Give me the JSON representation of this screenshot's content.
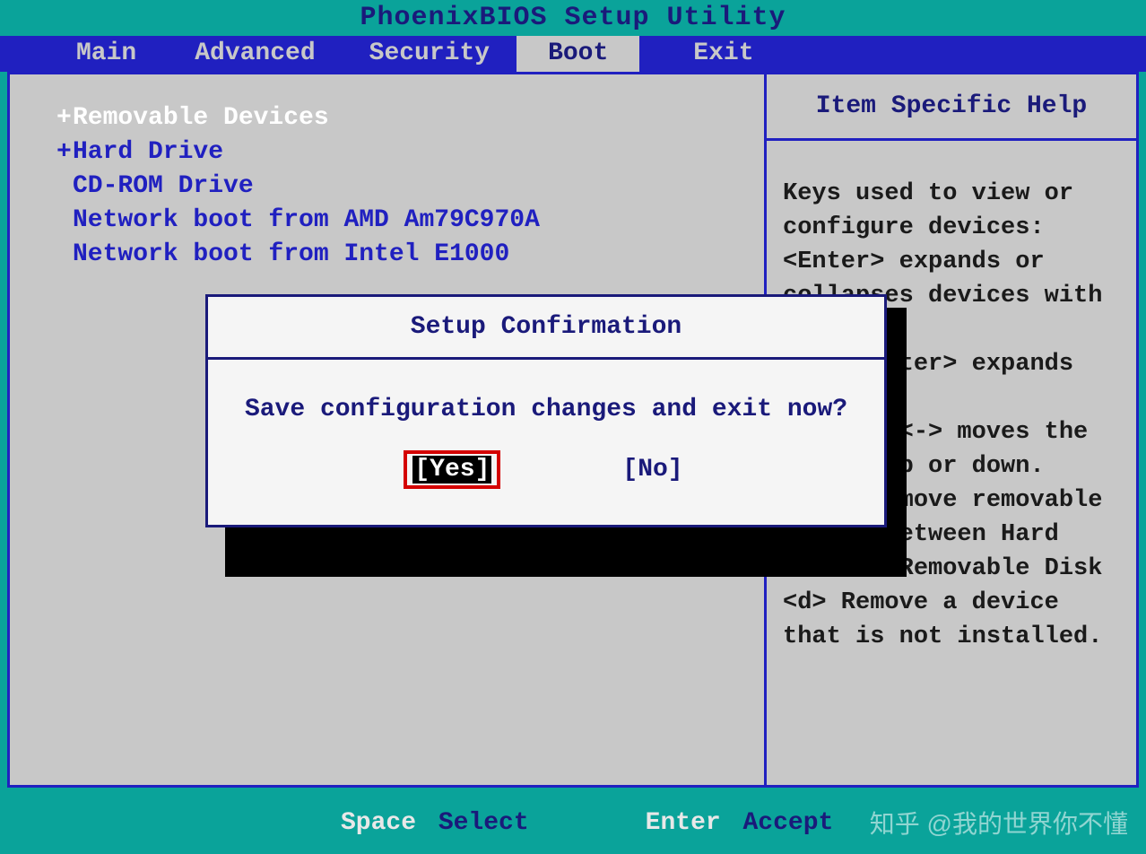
{
  "title": "PhoenixBIOS Setup Utility",
  "menu": {
    "main": "Main",
    "advanced": "Advanced",
    "security": "Security",
    "boot": "Boot",
    "exit": "Exit"
  },
  "boot_list": {
    "items": [
      {
        "prefix": "+",
        "label": "Removable Devices",
        "selected": true
      },
      {
        "prefix": "+",
        "label": "Hard Drive",
        "selected": false
      },
      {
        "prefix": " ",
        "label": "CD-ROM Drive",
        "selected": false
      },
      {
        "prefix": " ",
        "label": "Network boot from AMD Am79C970A",
        "selected": false
      },
      {
        "prefix": " ",
        "label": "Network boot from Intel E1000",
        "selected": false
      }
    ]
  },
  "help": {
    "header": "Item Specific Help",
    "body": "Keys used to view or configure devices:\n<Enter> expands or collapses devices with a + or -\n<Ctrl+Enter> expands all\n<+> and <-> moves the device up or down.\n<n> May move removable device between Hard Disk or Removable Disk\n<d> Remove a device that is not installed."
  },
  "dialog": {
    "title": "Setup Confirmation",
    "message": "Save configuration changes and exit now?",
    "yes": "[Yes]",
    "no": "[No]"
  },
  "footer": {
    "key1": "Space",
    "action1": "Select",
    "key2": "Enter",
    "action2": "Accept"
  },
  "watermark": "知乎 @我的世界你不懂"
}
